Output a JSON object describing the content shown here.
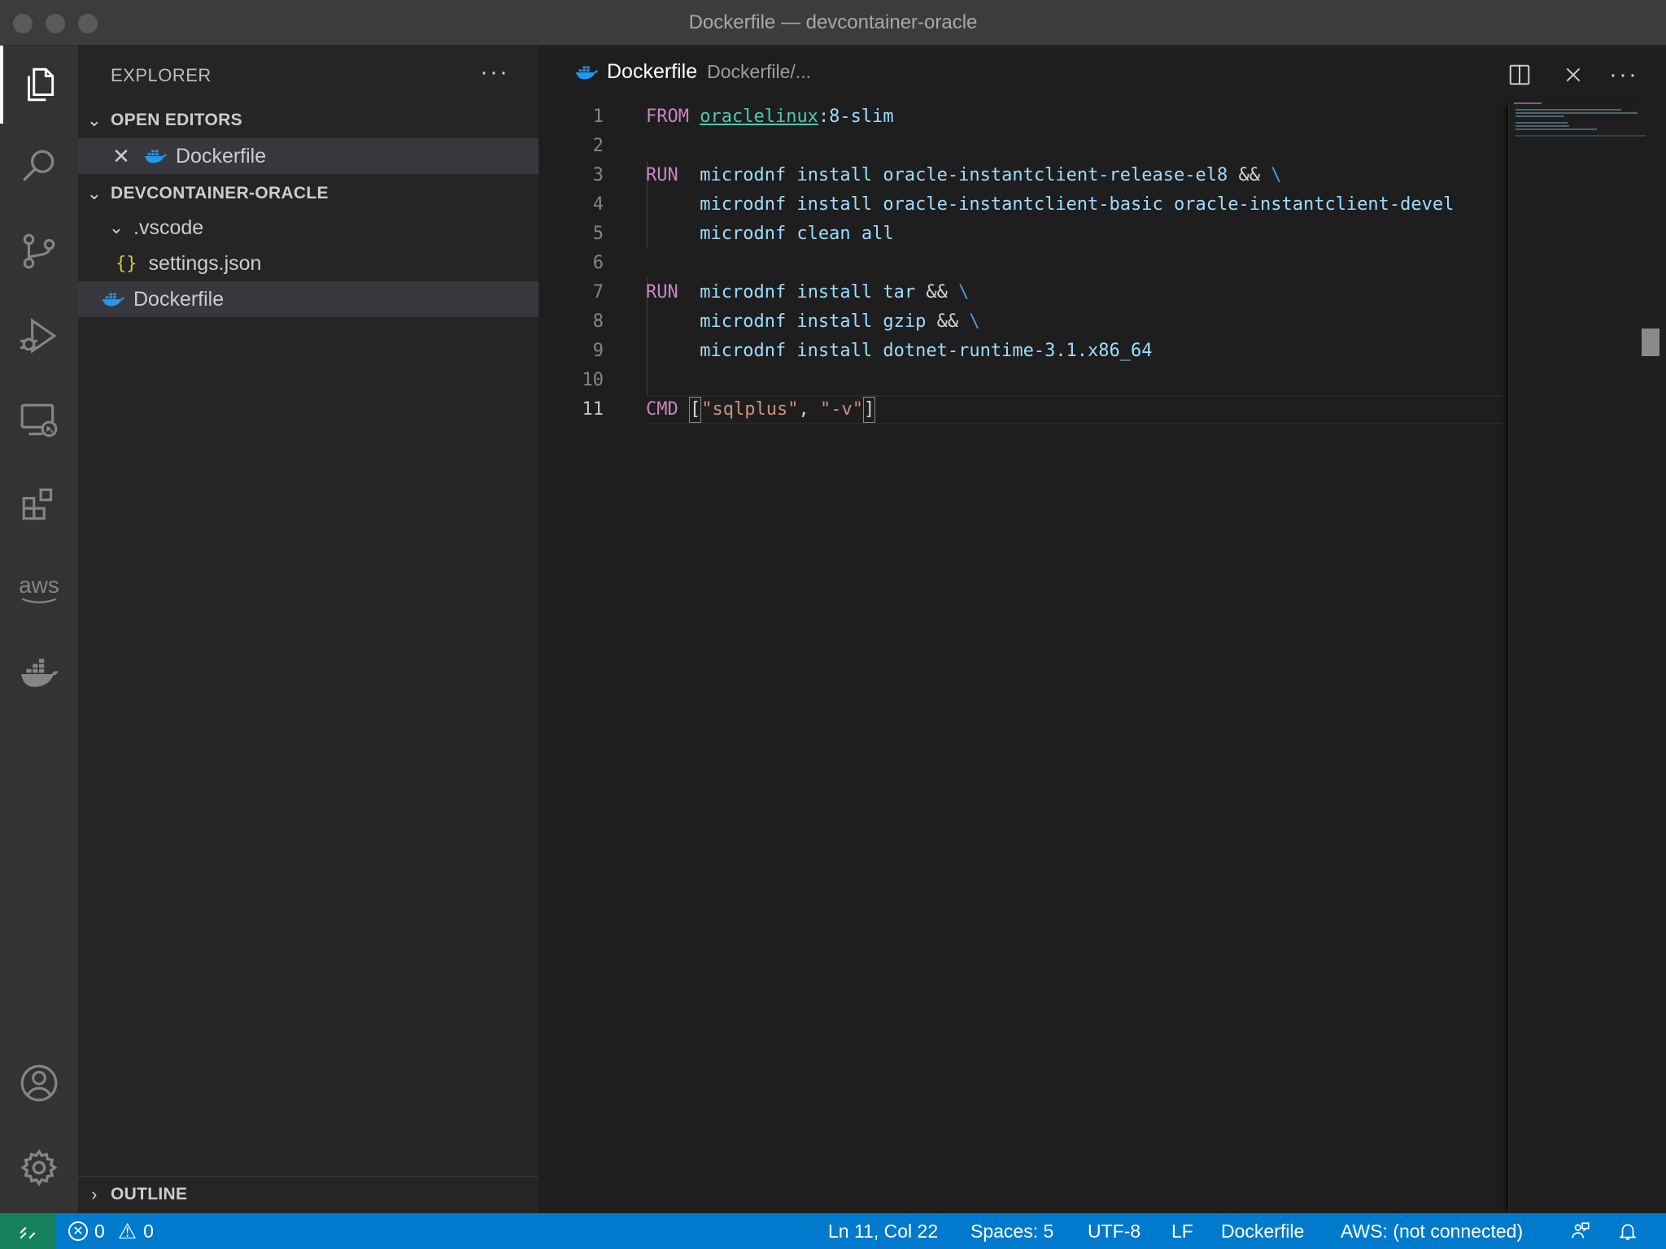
{
  "window": {
    "title": "Dockerfile — devcontainer-oracle"
  },
  "activity_bar": {
    "items": [
      "explorer-icon",
      "search-icon",
      "source-control-icon",
      "run-debug-icon",
      "remote-explorer-icon",
      "extensions-icon",
      "aws-icon",
      "docker-icon"
    ],
    "bottom": [
      "accounts-icon",
      "settings-gear-icon"
    ],
    "aws_label": "aws"
  },
  "sidebar": {
    "header": "EXPLORER",
    "more": "···",
    "open_editors": {
      "title": "OPEN EDITORS",
      "items": [
        {
          "label": "Dockerfile"
        }
      ]
    },
    "workspace": {
      "title": "DEVCONTAINER-ORACLE",
      "folder": ".vscode",
      "folder_child": "settings.json",
      "file": "Dockerfile"
    },
    "outline": "OUTLINE"
  },
  "tabs": [
    {
      "name": "Dockerfile",
      "description": "Dockerfile/..."
    }
  ],
  "editor": {
    "line_numbers": [
      "1",
      "2",
      "3",
      "4",
      "5",
      "6",
      "7",
      "8",
      "9",
      "10",
      "11"
    ],
    "current_line": "11",
    "code": {
      "l1_kw": "FROM",
      "l1_img": "oraclelinux",
      "l1_tag": ":8-slim",
      "l3_kw": "RUN",
      "l3_rest": "  microdnf install oracle-instantclient-release-el8 ",
      "l3_op": "&&",
      "l3_bsl": " \\",
      "l4": "     microdnf install oracle-instantclient-basic oracle-instantclient-devel",
      "l5": "     microdnf clean all",
      "l7_kw": "RUN",
      "l7_rest": "  microdnf install tar ",
      "l7_op": "&&",
      "l7_bsl": " \\",
      "l8_rest": "     microdnf install gzip ",
      "l8_op": "&&",
      "l8_bsl": " \\",
      "l9": "     microdnf install dotnet-runtime-3.1.x86_64",
      "l11_kw": "CMD",
      "l11_open": "[",
      "l11_s1": "\"sqlplus\"",
      "l11_comma": ", ",
      "l11_s2": "\"-v\"",
      "l11_close": "]"
    }
  },
  "status_bar": {
    "errors": "0",
    "warnings": "0",
    "position": "Ln 11, Col 22",
    "spaces": "Spaces: 5",
    "encoding": "UTF-8",
    "eol": "LF",
    "language": "Dockerfile",
    "aws": "AWS: (not connected)"
  },
  "colors": {
    "accent": "#007acc",
    "remote": "#16825d",
    "keyword": "#c586c0",
    "string": "#ce9178"
  }
}
